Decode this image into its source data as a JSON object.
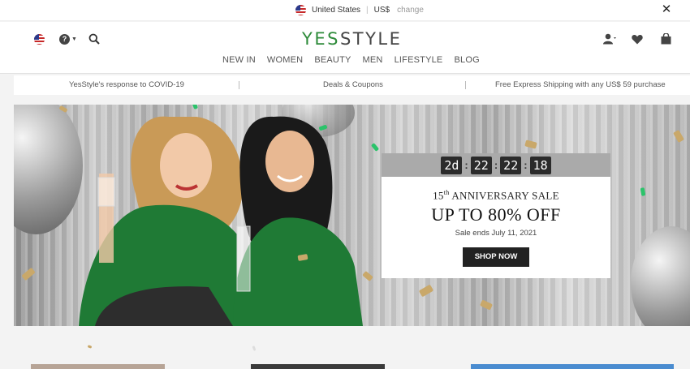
{
  "locale": {
    "country": "United States",
    "currency": "US$",
    "change": "change",
    "close_icon": "close-icon"
  },
  "header": {
    "logo_part1": "YES",
    "logo_part2": "STYLE",
    "icons_left": [
      "flag-icon",
      "help-icon",
      "search-icon"
    ],
    "icons_right": [
      "user-icon",
      "heart-icon",
      "bag-icon"
    ],
    "nav": [
      "NEW IN",
      "WOMEN",
      "BEAUTY",
      "MEN",
      "LIFESTYLE",
      "BLOG"
    ]
  },
  "promo": {
    "covid": "YesStyle's response to COVID-19",
    "deals": "Deals & Coupons",
    "shipping": "Free Express Shipping with any US$ 59 purchase"
  },
  "hero": {
    "countdown": {
      "days": "2d",
      "hours": "22",
      "minutes": "22",
      "seconds": "18"
    },
    "anniversary_num": "15",
    "anniversary_sup": "th",
    "anniversary_text": " ANNIVERSARY SALE",
    "headline": "UP TO 80% OFF",
    "ends": "Sale ends July 11, 2021",
    "cta": "SHOP NOW"
  },
  "colors": {
    "brand_green": "#2e8b3a",
    "confetti_gold": "#c9a86a",
    "confetti_green": "#2bc36a"
  }
}
